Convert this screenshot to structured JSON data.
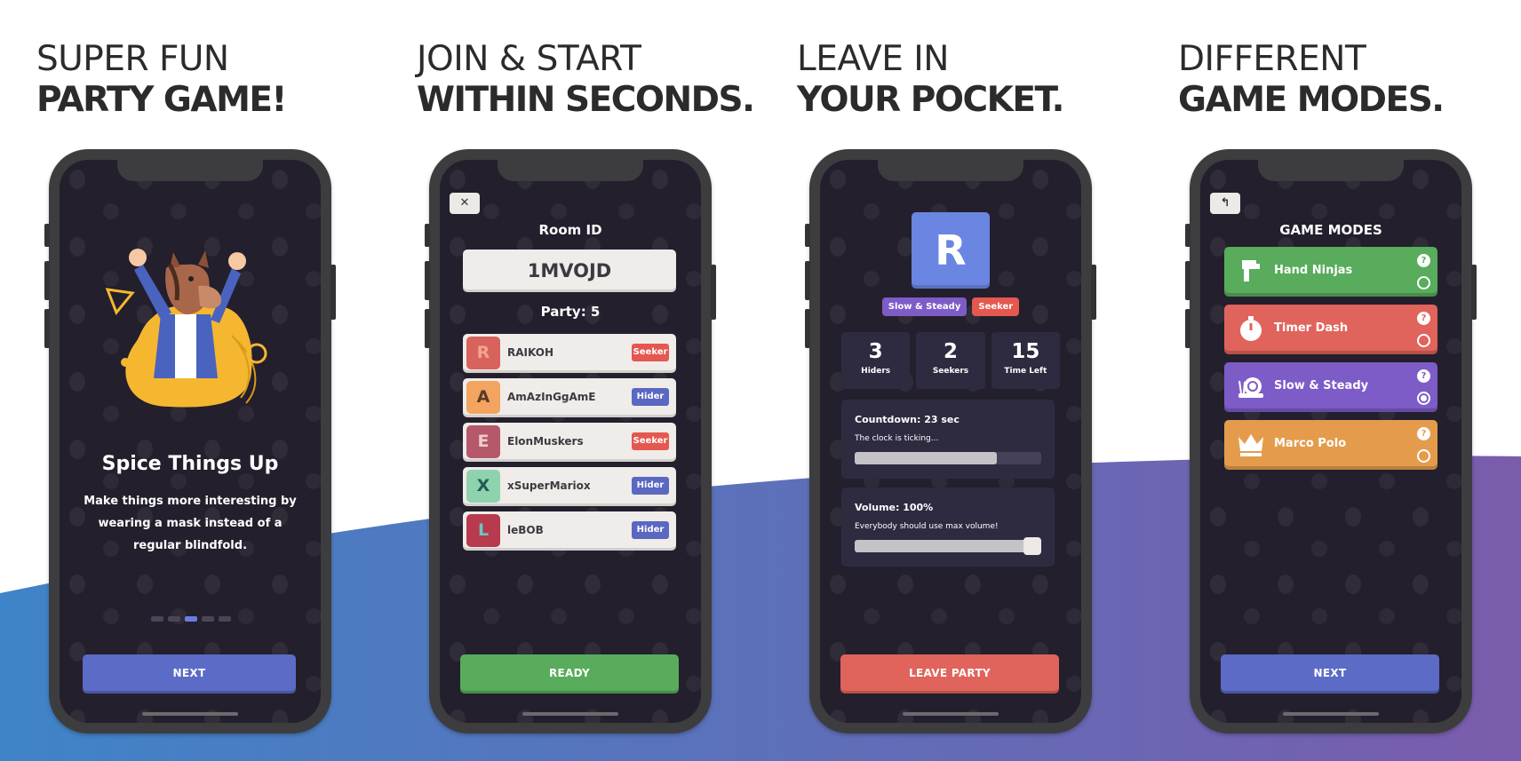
{
  "colors": {
    "wave_left": "#3f84c8",
    "wave_right": "#7a5cac",
    "screen_bg": "#231f2c",
    "blue_button": "#5b6bc6",
    "green_button": "#58ac5b",
    "red_button": "#e0645b",
    "seeker": "#e4584f",
    "hider": "#5a68c2"
  },
  "panels": [
    {
      "headline_line1": "SUPER FUN",
      "headline_line2": "PARTY GAME!",
      "title": "Spice Things Up",
      "description": "Make things more interesting by wearing a mask instead of a regular blindfold.",
      "page_dots": 5,
      "active_dot": 3,
      "button": "NEXT"
    },
    {
      "headline_line1": "JOIN & START",
      "headline_line2": "WITHIN SECONDS.",
      "close_icon": "close-icon",
      "room_label": "Room ID",
      "room_id": "1MVOJD",
      "party_label": "Party: 5",
      "players": [
        {
          "initial": "R",
          "name": "RAIKOH",
          "role": "Seeker",
          "avatar_bg": "#d8635c",
          "initial_color": "#f4a48f"
        },
        {
          "initial": "A",
          "name": "AmAzInGgAmE",
          "role": "Hider",
          "avatar_bg": "#f3a45e",
          "initial_color": "#5a3a28"
        },
        {
          "initial": "E",
          "name": "ElonMuskers",
          "role": "Seeker",
          "avatar_bg": "#b4586a",
          "initial_color": "#f2c8cc"
        },
        {
          "initial": "X",
          "name": "xSuperMariox",
          "role": "Hider",
          "avatar_bg": "#8fd3ae",
          "initial_color": "#235a58"
        },
        {
          "initial": "L",
          "name": "leBOB",
          "role": "Hider",
          "avatar_bg": "#b83a4d",
          "initial_color": "#6ac7c0"
        }
      ],
      "button": "READY"
    },
    {
      "headline_line1": "LEAVE IN",
      "headline_line2": "YOUR POCKET.",
      "player_initial": "R",
      "mode_tag": "Slow & Steady",
      "role_tag": "Seeker",
      "stats": [
        {
          "value": "3",
          "label": "Hiders"
        },
        {
          "value": "2",
          "label": "Seekers"
        },
        {
          "value": "15",
          "label": "Time Left"
        }
      ],
      "countdown_title": "Countdown: 23 sec",
      "countdown_sub": "The clock is ticking...",
      "countdown_progress": 0.76,
      "volume_title": "Volume: 100%",
      "volume_sub": "Everybody should use max volume!",
      "volume_level": 1.0,
      "button": "LEAVE PARTY"
    },
    {
      "headline_line1": "DIFFERENT",
      "headline_line2": "GAME MODES.",
      "back_icon": "back-arrow-icon",
      "title": "GAME MODES",
      "modes": [
        {
          "name": "Hand Ninjas",
          "color": "#58ac5b",
          "icon": "hand-pointer-icon",
          "selected": false
        },
        {
          "name": "Timer Dash",
          "color": "#e0645b",
          "icon": "stopwatch-icon",
          "selected": false
        },
        {
          "name": "Slow & Steady",
          "color": "#7d5cc8",
          "icon": "snail-icon",
          "selected": true
        },
        {
          "name": "Marco Polo",
          "color": "#e49c4c",
          "icon": "crown-icon",
          "selected": false
        }
      ],
      "help_glyph": "?",
      "button": "NEXT"
    }
  ]
}
